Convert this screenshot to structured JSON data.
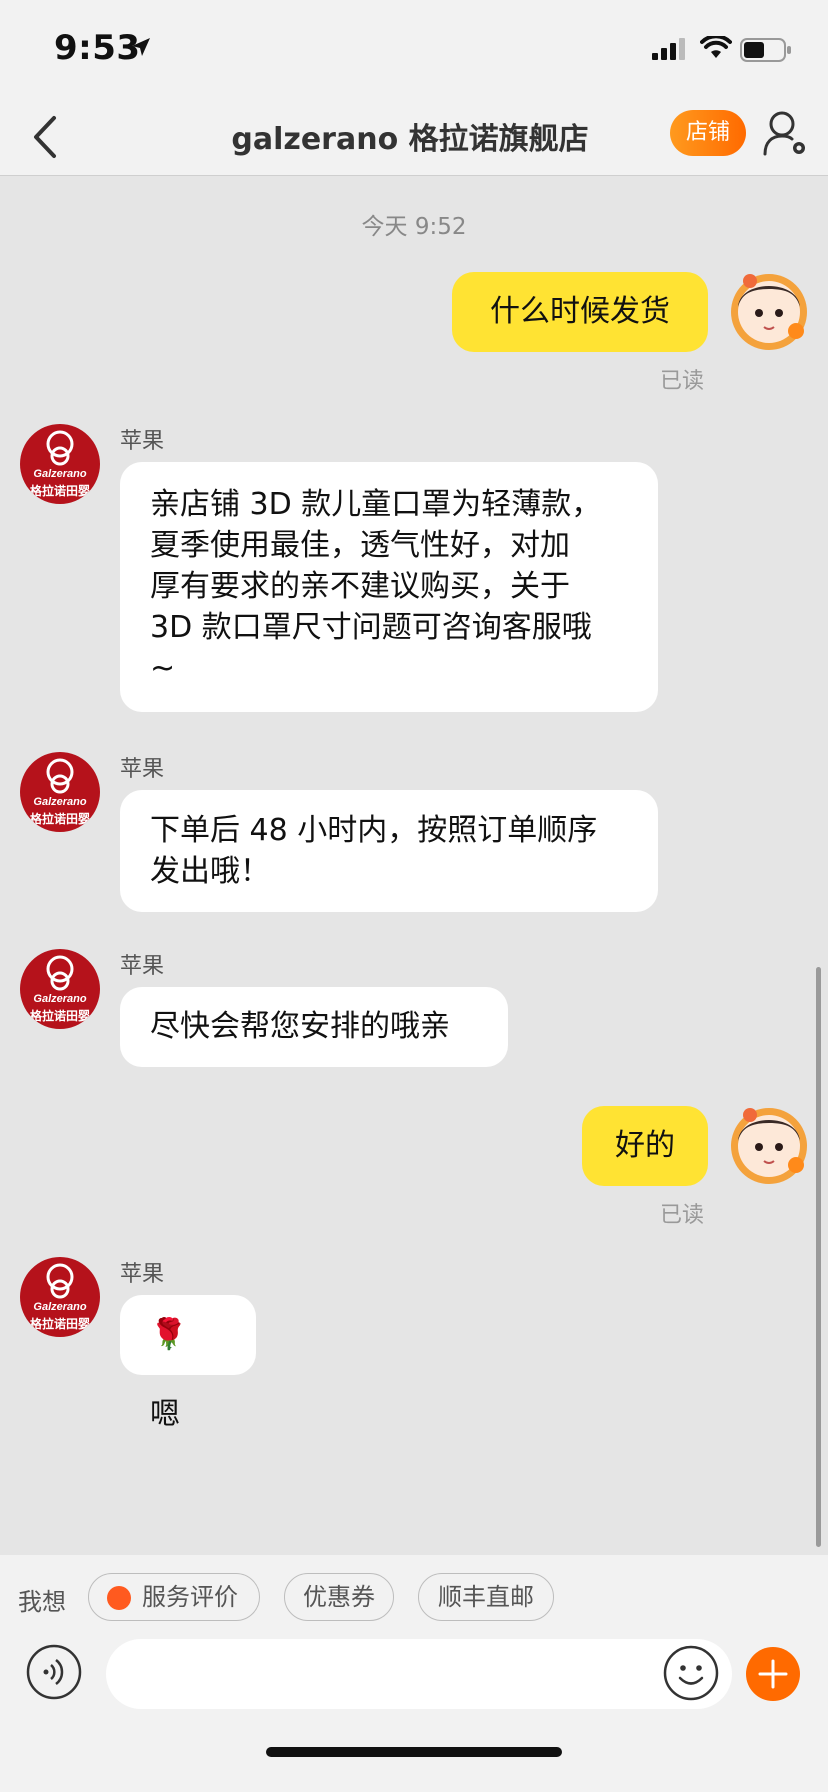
{
  "status_bar": {
    "time": "9:53"
  },
  "nav": {
    "title": "galzerano 格拉诺旗舰店",
    "shop_button": "店铺"
  },
  "chat": {
    "timestamp": "今天 9:52",
    "read_label": "已读",
    "sender_name": "苹果",
    "messages": [
      {
        "from": "me",
        "text": "什么时候发货"
      },
      {
        "from": "shop",
        "lines": [
          "亲店铺 3D 款儿童口罩为轻薄款，",
          "夏季使用最佳，透气性好，对加",
          "厚有要求的亲不建议购买，关于",
          "3D 款口罩尺寸问题可咨询客服哦",
          "~"
        ]
      },
      {
        "from": "shop",
        "lines": [
          "下单后 48 小时内，按照订单顺序",
          "发出哦！"
        ]
      },
      {
        "from": "shop",
        "text": "尽快会帮您安排的哦亲"
      },
      {
        "from": "me",
        "text": "好的"
      },
      {
        "from": "shop",
        "text": "🌹 嗯"
      }
    ]
  },
  "shop_logo": {
    "brand": "Galzerano",
    "cn": "格拉诺田婴"
  },
  "quick_bar": {
    "label": "我想",
    "chips": [
      "服务评价",
      "优惠券",
      "顺丰直邮"
    ]
  },
  "input": {
    "placeholder": ""
  },
  "colors": {
    "accent": "#ff6a00",
    "my_bubble": "#ffe333",
    "shop_red": "#b5121b"
  }
}
